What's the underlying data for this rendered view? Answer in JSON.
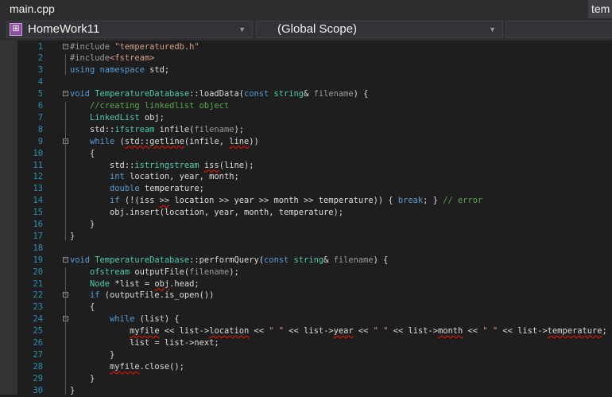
{
  "tabs": [
    {
      "label": "main.cpp",
      "active": true
    },
    {
      "label": "tem"
    }
  ],
  "nav": {
    "project": "HomeWork11",
    "scope": "(Global Scope)",
    "project_icon": "project-icon",
    "dropdown_icon": "chevron-down-icon"
  },
  "folds": [
    1,
    5,
    9,
    19,
    22,
    24
  ],
  "lines": [
    [
      [
        "m",
        "#include "
      ],
      [
        "s",
        "\"temperaturedb.h\""
      ]
    ],
    [
      [
        "m",
        "#include"
      ],
      [
        "s",
        "<fstream>"
      ]
    ],
    [
      [
        "k",
        "using"
      ],
      [
        "n",
        " "
      ],
      [
        "k",
        "namespace"
      ],
      [
        "n",
        " std;"
      ]
    ],
    [],
    [
      [
        "k",
        "void"
      ],
      [
        "n",
        " "
      ],
      [
        "t",
        "TemperatureDatabase"
      ],
      [
        "n",
        "::loadData("
      ],
      [
        "k",
        "const"
      ],
      [
        "n",
        " "
      ],
      [
        "t",
        "string"
      ],
      [
        "n",
        "& "
      ],
      [
        "p",
        "filename"
      ],
      [
        "n",
        ") {"
      ]
    ],
    [
      [
        "n",
        "    "
      ],
      [
        "c",
        "//creating linkedlist object"
      ]
    ],
    [
      [
        "n",
        "    "
      ],
      [
        "t",
        "LinkedList"
      ],
      [
        "n",
        " obj;"
      ]
    ],
    [
      [
        "n",
        "    std::"
      ],
      [
        "t",
        "ifstream"
      ],
      [
        "n",
        " infile("
      ],
      [
        "p",
        "filename"
      ],
      [
        "n",
        ");"
      ]
    ],
    [
      [
        "n",
        "    "
      ],
      [
        "k",
        "while"
      ],
      [
        "n",
        " ("
      ],
      [
        "n e",
        "std::getline"
      ],
      [
        "n",
        "(infile, "
      ],
      [
        "n e",
        "line"
      ],
      [
        "n",
        "))"
      ]
    ],
    [
      [
        "n",
        "    {"
      ]
    ],
    [
      [
        "n",
        "        std::"
      ],
      [
        "t",
        "istringstream"
      ],
      [
        "n",
        " "
      ],
      [
        "n e",
        "iss"
      ],
      [
        "n",
        "(line);"
      ]
    ],
    [
      [
        "n",
        "        "
      ],
      [
        "k",
        "int"
      ],
      [
        "n",
        " location, year, month;"
      ]
    ],
    [
      [
        "n",
        "        "
      ],
      [
        "k",
        "double"
      ],
      [
        "n",
        " temperature;"
      ]
    ],
    [
      [
        "n",
        "        "
      ],
      [
        "k",
        "if"
      ],
      [
        "n",
        " (!(iss "
      ],
      [
        "n e",
        ">>"
      ],
      [
        "n",
        " location >> year >> month >> temperature)) { "
      ],
      [
        "k",
        "break"
      ],
      [
        "n",
        "; } "
      ],
      [
        "c",
        "// error"
      ]
    ],
    [
      [
        "n",
        "        obj.insert(location, year, month, temperature);"
      ]
    ],
    [
      [
        "n",
        "    }"
      ]
    ],
    [
      [
        "n",
        "}"
      ]
    ],
    [],
    [
      [
        "k",
        "void"
      ],
      [
        "n",
        " "
      ],
      [
        "t",
        "TemperatureDatabase"
      ],
      [
        "n",
        "::performQuery("
      ],
      [
        "k",
        "const"
      ],
      [
        "n",
        " "
      ],
      [
        "t",
        "string"
      ],
      [
        "n",
        "& "
      ],
      [
        "p",
        "filename"
      ],
      [
        "n",
        ") {"
      ]
    ],
    [
      [
        "n",
        "    "
      ],
      [
        "t",
        "ofstream"
      ],
      [
        "n",
        " outputFile("
      ],
      [
        "p",
        "filename"
      ],
      [
        "n",
        ");"
      ]
    ],
    [
      [
        "n",
        "    "
      ],
      [
        "t",
        "Node"
      ],
      [
        "n",
        " *list = "
      ],
      [
        "n e",
        "obj"
      ],
      [
        "n",
        ".head;"
      ]
    ],
    [
      [
        "n",
        "    "
      ],
      [
        "k",
        "if"
      ],
      [
        "n",
        " (outputFile.is_open())"
      ]
    ],
    [
      [
        "n",
        "    {"
      ]
    ],
    [
      [
        "n",
        "        "
      ],
      [
        "k",
        "while"
      ],
      [
        "n",
        " (list) {"
      ]
    ],
    [
      [
        "n",
        "            "
      ],
      [
        "n e",
        "myfile"
      ],
      [
        "n",
        " << list->"
      ],
      [
        "n e",
        "location"
      ],
      [
        "n",
        " << "
      ],
      [
        "s",
        "\" \""
      ],
      [
        "n",
        " << list->"
      ],
      [
        "n e",
        "year"
      ],
      [
        "n",
        " << "
      ],
      [
        "s",
        "\" \""
      ],
      [
        "n",
        " << list->"
      ],
      [
        "n e",
        "month"
      ],
      [
        "n",
        " << "
      ],
      [
        "s",
        "\" \""
      ],
      [
        "n",
        " << list->"
      ],
      [
        "n e",
        "temperature"
      ],
      [
        "n",
        ";"
      ]
    ],
    [
      [
        "n",
        "            list = list->next;"
      ]
    ],
    [
      [
        "n",
        "        }"
      ]
    ],
    [
      [
        "n",
        "        "
      ],
      [
        "n e",
        "myfile"
      ],
      [
        "n",
        ".close();"
      ]
    ],
    [
      [
        "n",
        "    }"
      ]
    ],
    [
      [
        "n",
        "}"
      ]
    ]
  ]
}
